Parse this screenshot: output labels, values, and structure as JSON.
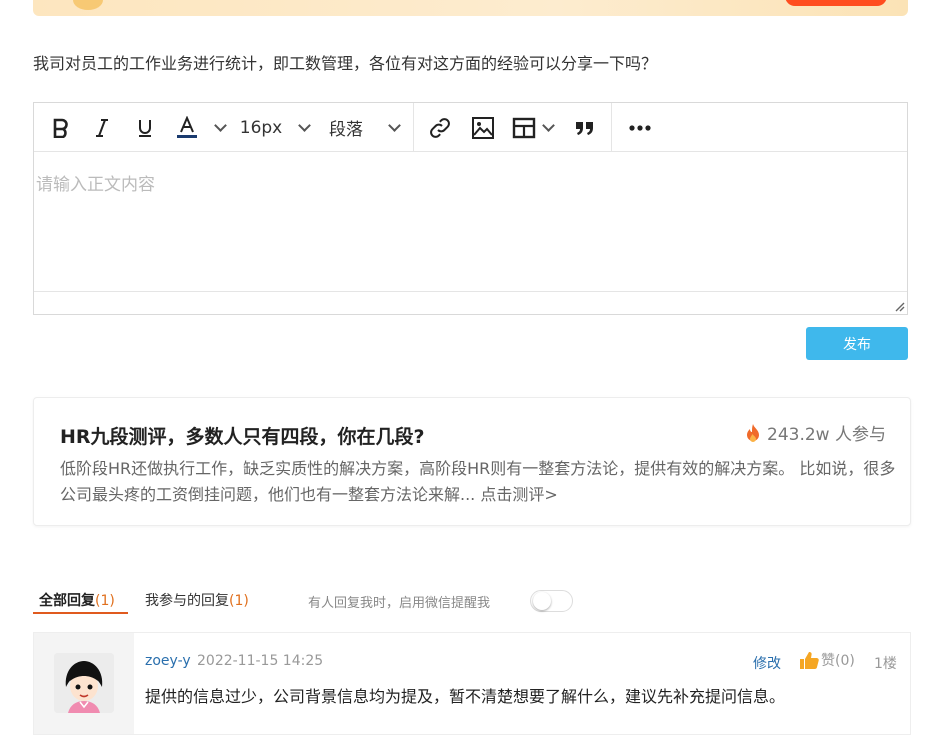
{
  "question": "我司对员工的工作业务进行统计，即工数管理，各位有对这方面的经验可以分享一下吗？",
  "editor": {
    "font_size": "16px",
    "paragraph": "段落",
    "placeholder": "请输入正文内容",
    "publish_label": "发布"
  },
  "promo": {
    "title": "HR九段测评，多数人只有四段，你在几段?",
    "count": "243.2w 人参与",
    "description": "低阶段HR还做执行工作，缺乏实质性的解决方案，高阶段HR则有一整套方法论，提供有效的解决方案。 比如说，很多公司最头疼的工资倒挂问题，他们也有一整套方法论来解... 点击测评>"
  },
  "tabs": {
    "all_label": "全部回复",
    "all_count": "(1)",
    "mine_label": "我参与的回复",
    "mine_count": "(1)",
    "notify_label": "有人回复我时，启用微信提醒我",
    "notify_enabled": false
  },
  "reply": {
    "user": "zoey-y",
    "time": "2022-11-15 14:25",
    "edit_label": "修改",
    "like_label": "赞(0)",
    "floor": "1楼",
    "text": "提供的信息过少，公司背景信息均为提及，暂不清楚想要了解什么，建议先补充提问信息。"
  },
  "colors": {
    "accent_blue": "#3fb8ec",
    "link_blue": "#2a6fad",
    "tab_underline": "#e05a1e",
    "count_orange": "#e0701e"
  }
}
